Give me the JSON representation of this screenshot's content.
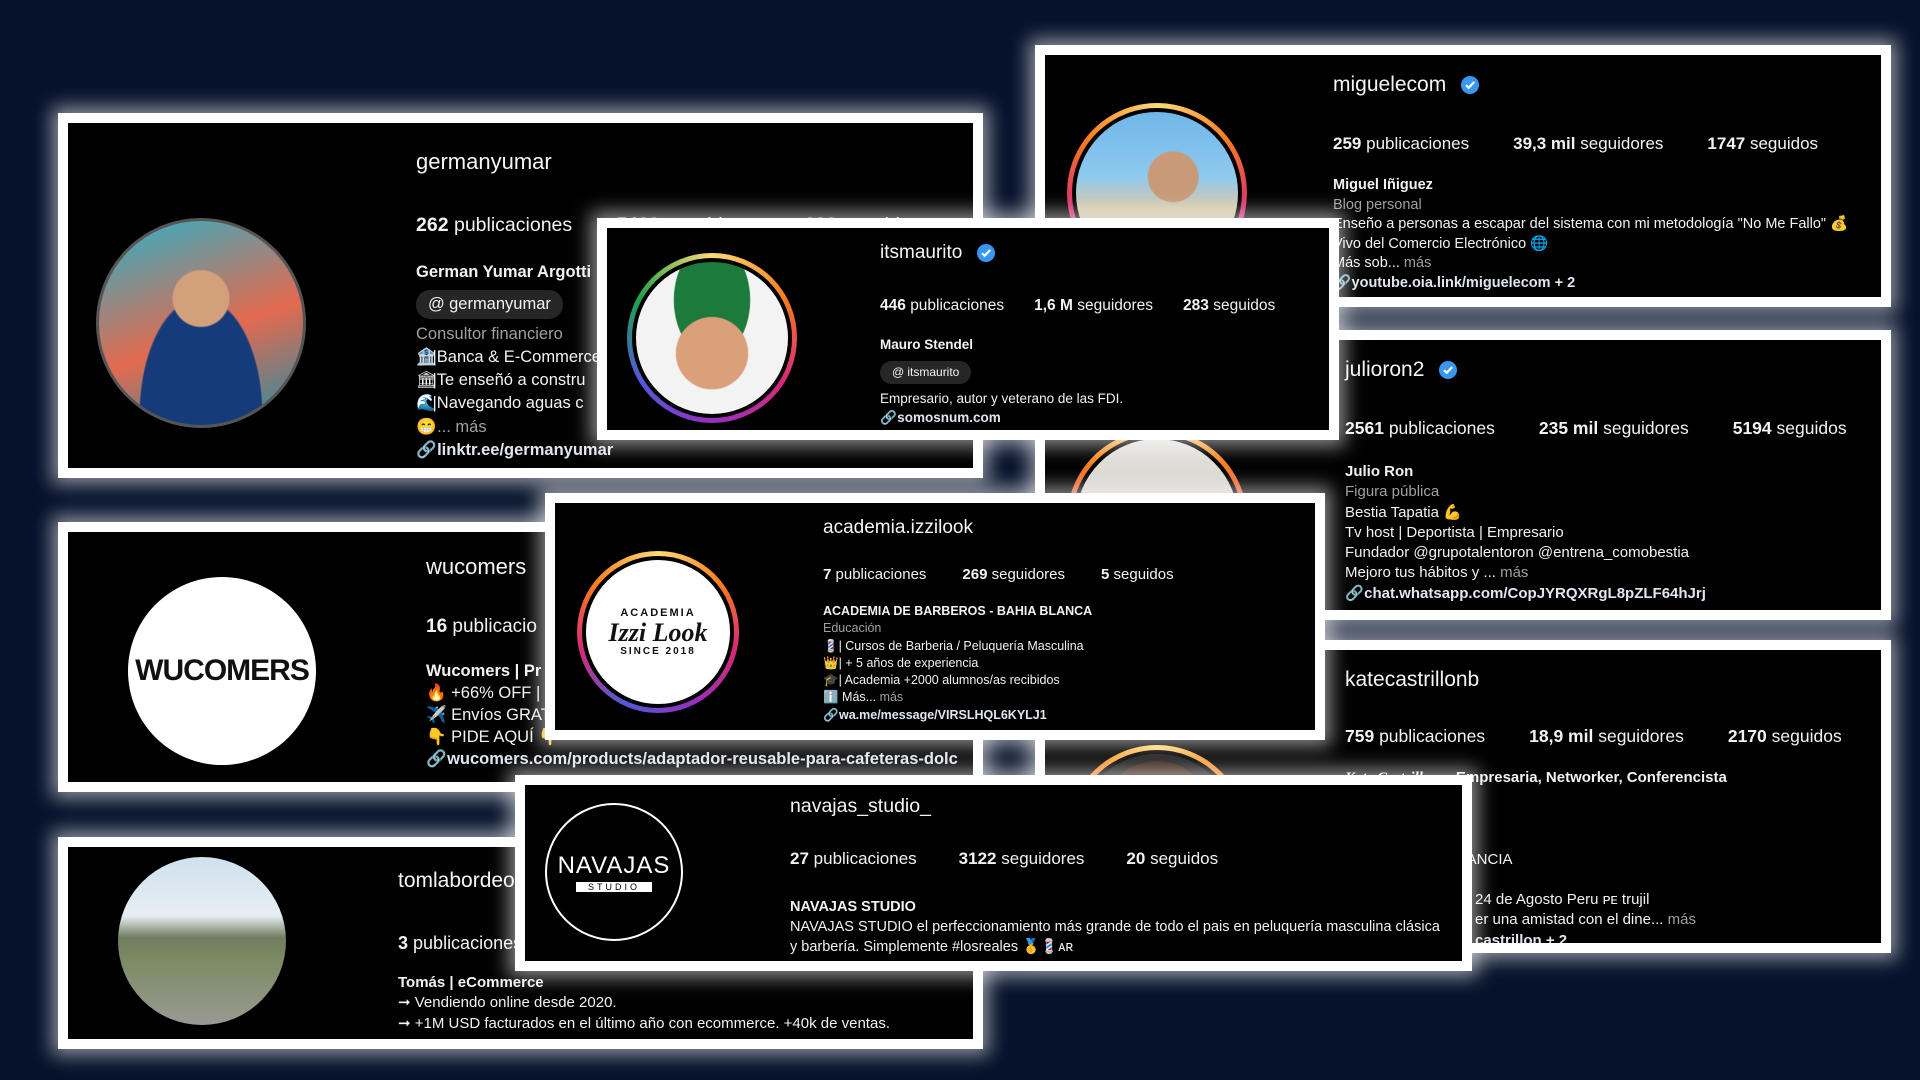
{
  "cards": {
    "germanyumar": {
      "username": "germanyumar",
      "posts_count": "262",
      "posts_label": "publicaciones",
      "followers_count": "5488",
      "followers_label": "seguidores",
      "following_count": "698",
      "following_label": "seguidos",
      "name": "German Yumar Argotti",
      "threads_handle": "germanyumar",
      "category": "Consultor financiero",
      "bio_lines": [
        "|Banca & E-Commerce",
        "|Te enseñó a constru",
        "|Navegando aguas c",
        "... más"
      ],
      "link": "linktr.ee/germanyumar"
    },
    "itsmaurito": {
      "username": "itsmaurito",
      "posts_count": "446",
      "posts_label": "publicaciones",
      "followers_count": "1,6 M",
      "followers_label": "seguidores",
      "following_count": "283",
      "following_label": "seguidos",
      "name": "Mauro Stendel",
      "threads_handle": "itsmaurito",
      "bio": "Empresario, autor y veterano de las FDI.",
      "link": "somosnum.com"
    },
    "miguelecom": {
      "username": "miguelecom",
      "posts_count": "259",
      "posts_label": "publicaciones",
      "followers_count": "39,3 mil",
      "followers_label": "seguidores",
      "following_count": "1747",
      "following_label": "seguidos",
      "name": "Miguel Iñiguez",
      "category": "Blog personal",
      "bio_lines": [
        "Enseño a personas a escapar del sistema con mi metodología \"No Me Fallo\" 💰",
        "Vivo del Comercio Electrónico 🌐",
        "Más sob..."
      ],
      "more": "más",
      "link": "youtube.oia.link/miguelecom + 2"
    },
    "julioron2": {
      "username": "julioron2",
      "posts_count": "2561",
      "posts_label": "publicaciones",
      "followers_count": "235 mil",
      "followers_label": "seguidores",
      "following_count": "5194",
      "following_label": "seguidos",
      "name": "Julio Ron",
      "category": "Figura pública",
      "bio_lines": [
        "Bestia Tapatia 💪",
        "Tv host | Deportista | Empresario",
        "Fundador @grupotalentoron @entrena_comobestia",
        "Mejoro tus hábitos y ..."
      ],
      "more": "más",
      "link": "chat.whatsapp.com/CopJYRQXRgL8pZLF64hJrj"
    },
    "wucomers": {
      "username": "wucomers",
      "logo_text": "WUCOMERS",
      "posts_count": "16",
      "posts_label": "publicacio",
      "name": "Wucomers | Pr",
      "bio_lines": [
        "🔥 +66% OFF |",
        "✈️ Envíos GRAT",
        "👇 PIDE AQUÍ 👇"
      ],
      "link": "wucomers.com/products/adaptador-reusable-para-cafeteras-dolc"
    },
    "izzilook": {
      "username": "academia.izzilook",
      "logo_top": "ACADEMIA",
      "logo_main": "Izzi Look",
      "logo_bottom": "SINCE 2018",
      "posts_count": "7",
      "posts_label": "publicaciones",
      "followers_count": "269",
      "followers_label": "seguidores",
      "following_count": "5",
      "following_label": "seguidos",
      "name": "ACADEMIA DE BARBEROS - BAHIA BLANCA",
      "category": "Educación",
      "bio_lines": [
        "💈| Cursos de Barberia / Peluquería Masculina",
        "👑| + 5 años de experiencia",
        "🎓| Academia +2000 alumnos/as recibidos",
        "ℹ️ Más..."
      ],
      "more": "más",
      "link": "wa.me/message/VIRSLHQL6KYLJ1"
    },
    "katecastrillonb": {
      "username": "katecastrillonb",
      "posts_count": "759",
      "posts_label": "publicaciones",
      "followers_count": "18,9 mil",
      "followers_label": "seguidores",
      "following_count": "2170",
      "following_label": "seguidos",
      "name_styled": "Kate Castrillon",
      "name_rest": "~ Empresaria, Networker, Conferencista",
      "bio_lines": [
        "NDANCIA",
        "24 de Agosto Peru ᴘᴇ trujil",
        "er una amistad con el dine..."
      ],
      "more": "más",
      "link": "castrillon + 2"
    },
    "tomlabordeo": {
      "username": "tomlabordeo",
      "posts_count": "3",
      "posts_label": "publicaciones",
      "name": "Tomás | eCommerce",
      "bio_lines": [
        "➞ Vendiendo online desde 2020.",
        "➞ +1M USD facturados en el último año con ecommerce. +40k de ventas."
      ]
    },
    "navajas": {
      "username": "navajas_studio_",
      "logo_text": "NAVAJAS",
      "logo_sub": "STUDIO",
      "posts_count": "27",
      "posts_label": "publicaciones",
      "followers_count": "3122",
      "followers_label": "seguidores",
      "following_count": "20",
      "following_label": "seguidos",
      "name": "NAVAJAS STUDIO",
      "bio_lines": [
        "NAVAJAS STUDIO el perfeccionamiento más grande de todo el pais en peluquería masculina clásica",
        "y barbería. Simplemente #losreales 🥇💈ᴀʀ"
      ]
    }
  },
  "colors": {
    "background": "#06122b",
    "card": "#000000",
    "border": "#ffffff",
    "verified": "#3897f0"
  }
}
